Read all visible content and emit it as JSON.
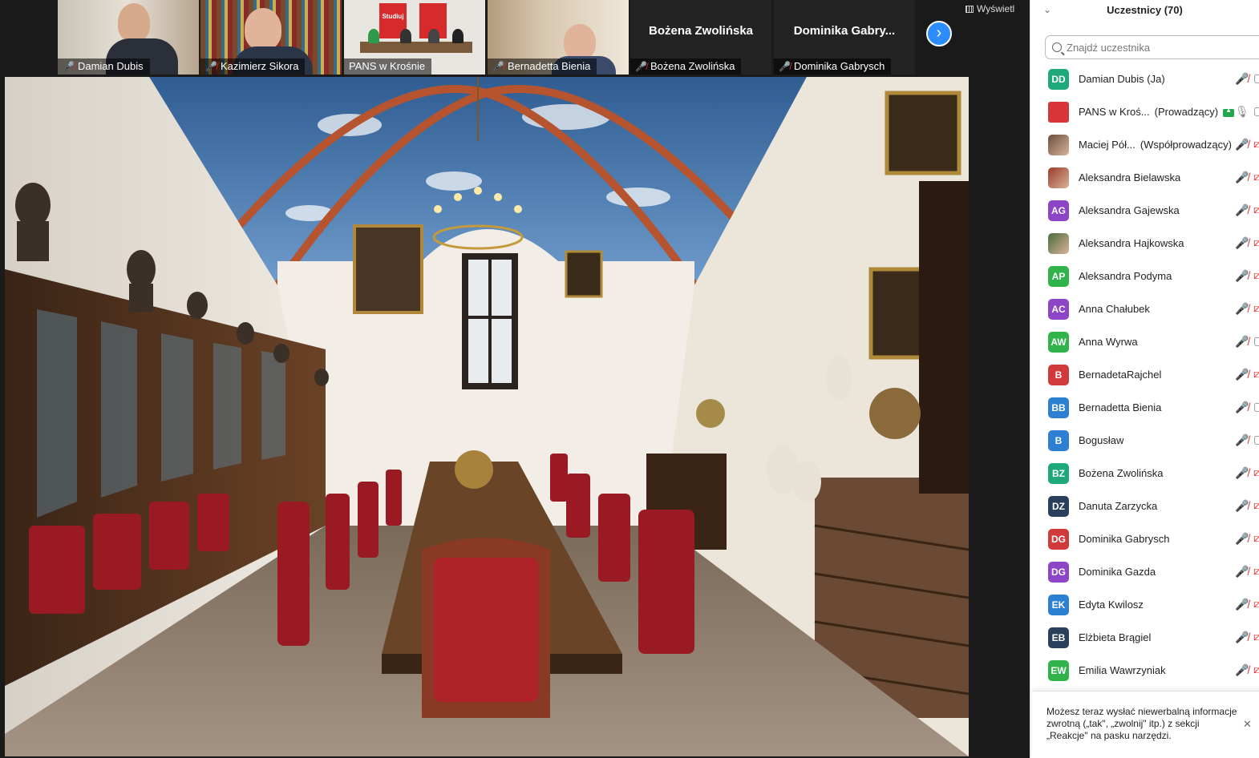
{
  "thumbnails": [
    {
      "name": "Damian Dubis",
      "muted": true,
      "video": true
    },
    {
      "name": "Kazimierz Sikora",
      "muted": true,
      "video": true
    },
    {
      "name": "PANS w Krośnie",
      "muted": false,
      "video": true,
      "poster_text": "Studiuj"
    },
    {
      "name": "Bernadetta Bienia",
      "muted": true,
      "video": true
    },
    {
      "name": "Bożena Zwolińska",
      "muted": true,
      "video": false,
      "display_name": "Bożena Zwolińska"
    },
    {
      "name": "Dominika Gabrysch",
      "muted": true,
      "video": false,
      "display_name": "Dominika  Gabry..."
    }
  ],
  "view_button": {
    "label": "Wyświetl"
  },
  "panel": {
    "title": "Uczestnicy (70)",
    "search_placeholder": "Znajdź uczestnika",
    "participants": [
      {
        "initials": "DD",
        "name": "Damian Dubis (Ja)",
        "color": "#1fa87a",
        "mic": "muted",
        "cam": "on"
      },
      {
        "initials": "",
        "name": "PANS w Kroś...",
        "role": "(Prowadzący)",
        "color": "#d73636",
        "avatar_type": "logo",
        "host": true,
        "mic": "on",
        "cam": "on"
      },
      {
        "initials": "",
        "name": "Maciej Pół...",
        "role": "(Współprowadzący)",
        "color": "#6a4e3e",
        "avatar_type": "photo",
        "mic": "muted",
        "cam": "off"
      },
      {
        "initials": "",
        "name": "Aleksandra Bielawska",
        "color": "#9b3a2a",
        "avatar_type": "photo",
        "mic": "muted",
        "cam": "off"
      },
      {
        "initials": "AG",
        "name": "Aleksandra Gajewska",
        "color": "#8e44c7",
        "mic": "muted",
        "cam": "off"
      },
      {
        "initials": "",
        "name": "Aleksandra Hajkowska",
        "color": "#4b6a3a",
        "avatar_type": "photo",
        "mic": "muted",
        "cam": "off"
      },
      {
        "initials": "AP",
        "name": "Aleksandra Podyma",
        "color": "#2fb34a",
        "mic": "muted",
        "cam": "off"
      },
      {
        "initials": "AC",
        "name": "Anna Chałubek",
        "color": "#8e44c7",
        "mic": "muted",
        "cam": "off"
      },
      {
        "initials": "AW",
        "name": "Anna Wyrwa",
        "color": "#2fb34a",
        "mic": "muted",
        "cam": "on"
      },
      {
        "initials": "B",
        "name": "BernadetaRajchel",
        "color": "#d03a3a",
        "mic": "muted",
        "cam": "off"
      },
      {
        "initials": "BB",
        "name": "Bernadetta Bienia",
        "color": "#2d7fd1",
        "mic": "muted",
        "cam": "on"
      },
      {
        "initials": "B",
        "name": "Bogusław",
        "color": "#2d7fd1",
        "mic": "muted",
        "cam": "on"
      },
      {
        "initials": "BZ",
        "name": "Bożena Zwolińska",
        "color": "#1fa87a",
        "mic": "muted",
        "cam": "off"
      },
      {
        "initials": "DZ",
        "name": "Danuta Zarzycka",
        "color": "#2a3f5c",
        "mic": "muted",
        "cam": "off"
      },
      {
        "initials": "DG",
        "name": "Dominika Gabrysch",
        "color": "#d03a3a",
        "mic": "muted",
        "cam": "off"
      },
      {
        "initials": "DG",
        "name": "Dominika Gazda",
        "color": "#8e44c7",
        "mic": "muted",
        "cam": "off"
      },
      {
        "initials": "EK",
        "name": "Edyta Kwilosz",
        "color": "#2d7fd1",
        "mic": "muted",
        "cam": "off"
      },
      {
        "initials": "EB",
        "name": "Elżbieta Brągiel",
        "color": "#2a3f5c",
        "mic": "muted",
        "cam": "off"
      },
      {
        "initials": "EW",
        "name": "Emilia Wawrzyniak",
        "color": "#2fb34a",
        "mic": "muted",
        "cam": "off"
      }
    ]
  },
  "toast": {
    "text": "Możesz teraz wysłać niewerbalną informacje zwrotną („tak\", „zwolnij\" itp.) z sekcji „Reakcje\" na pasku narzędzi."
  }
}
